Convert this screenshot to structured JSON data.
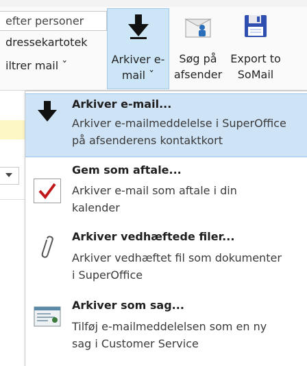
{
  "ribbon": {
    "search_text": "efter personer",
    "address_book": "dressekartotek",
    "filter_mail": "iltrer mail ˇ",
    "buttons": [
      {
        "line1": "Arkiver e-",
        "line2": "mail ˇ",
        "icon": "archive-down-arrow-icon"
      },
      {
        "line1": "Søg på",
        "line2": "afsender",
        "icon": "contact-card-icon"
      },
      {
        "line1": "Export to",
        "line2": "SoMail",
        "icon": "floppy-disk-icon"
      }
    ]
  },
  "menu": {
    "items": [
      {
        "title": "Arkiver e-mail...",
        "desc_lines": [
          "Arkiver e-mailmeddelelse i SuperOffice",
          "på afsenderens kontaktkort"
        ],
        "icon": "archive-down-arrow-icon"
      },
      {
        "title": "Gem som aftale...",
        "desc_lines": [
          "Arkiver e-mail som aftale i din",
          "kalender"
        ],
        "icon": "checkmark-icon"
      },
      {
        "title": "Arkiver vedhæftede filer...",
        "desc_lines": [
          "Arkiver vedhæftet fil som dokumenter",
          "i SuperOffice"
        ],
        "icon": "paperclip-icon"
      },
      {
        "title": "Arkiver som sag...",
        "desc_lines": [
          "Tilføj e-mailmeddelelsen som en ny",
          "sag i Customer Service"
        ],
        "icon": "request-ticket-icon"
      }
    ]
  },
  "colors": {
    "highlight": "#cfe3f6",
    "active_button": "#cde6f7",
    "check_red": "#c0171b",
    "floppy_blue": "#2f4fb0"
  }
}
